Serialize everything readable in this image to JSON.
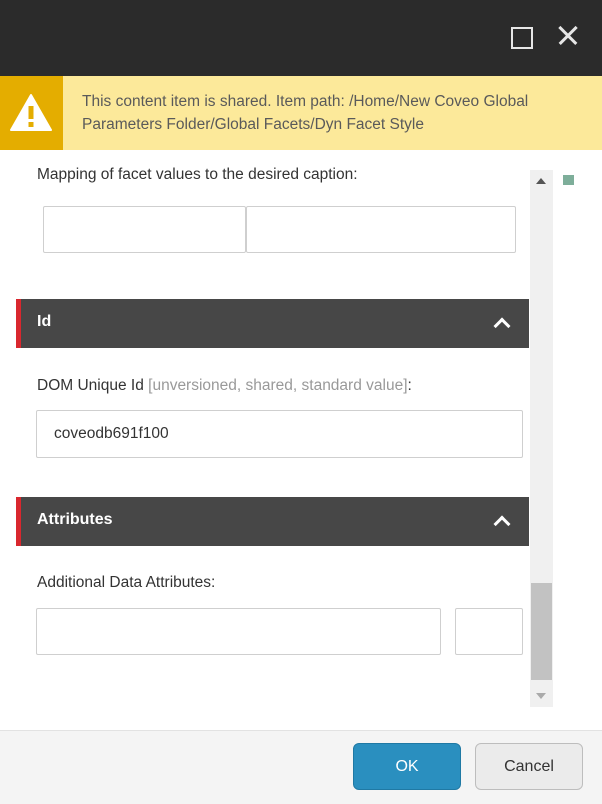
{
  "window": {
    "maximize_icon": "maximize-icon",
    "close_icon": "close-icon"
  },
  "warning": {
    "icon": "warning-icon",
    "text": "This content item is shared. Item path: /Home/New Coveo Global Parameters Folder/Global Facets/Dyn Facet Style",
    "colors": {
      "background": "#fce99a",
      "icon_background": "#e4ad00"
    }
  },
  "mapping": {
    "label": "Mapping of facet values to the desired caption:",
    "key_value": "",
    "caption_value": ""
  },
  "sections": {
    "id": {
      "title": "Id",
      "field_label": "DOM Unique Id",
      "field_meta": "[unversioned, shared, standard value]",
      "field_suffix": ":",
      "field_value": "coveodb691f100"
    },
    "attributes": {
      "title": "Attributes",
      "field_label": "Additional Data Attributes:",
      "key_value": "",
      "value_value": ""
    }
  },
  "footer": {
    "ok_label": "OK",
    "cancel_label": "Cancel"
  },
  "colors": {
    "titlebar": "#2b2b2b",
    "section_header": "#474747",
    "section_accent": "#d9272e",
    "ok_button": "#2a8fbf"
  }
}
